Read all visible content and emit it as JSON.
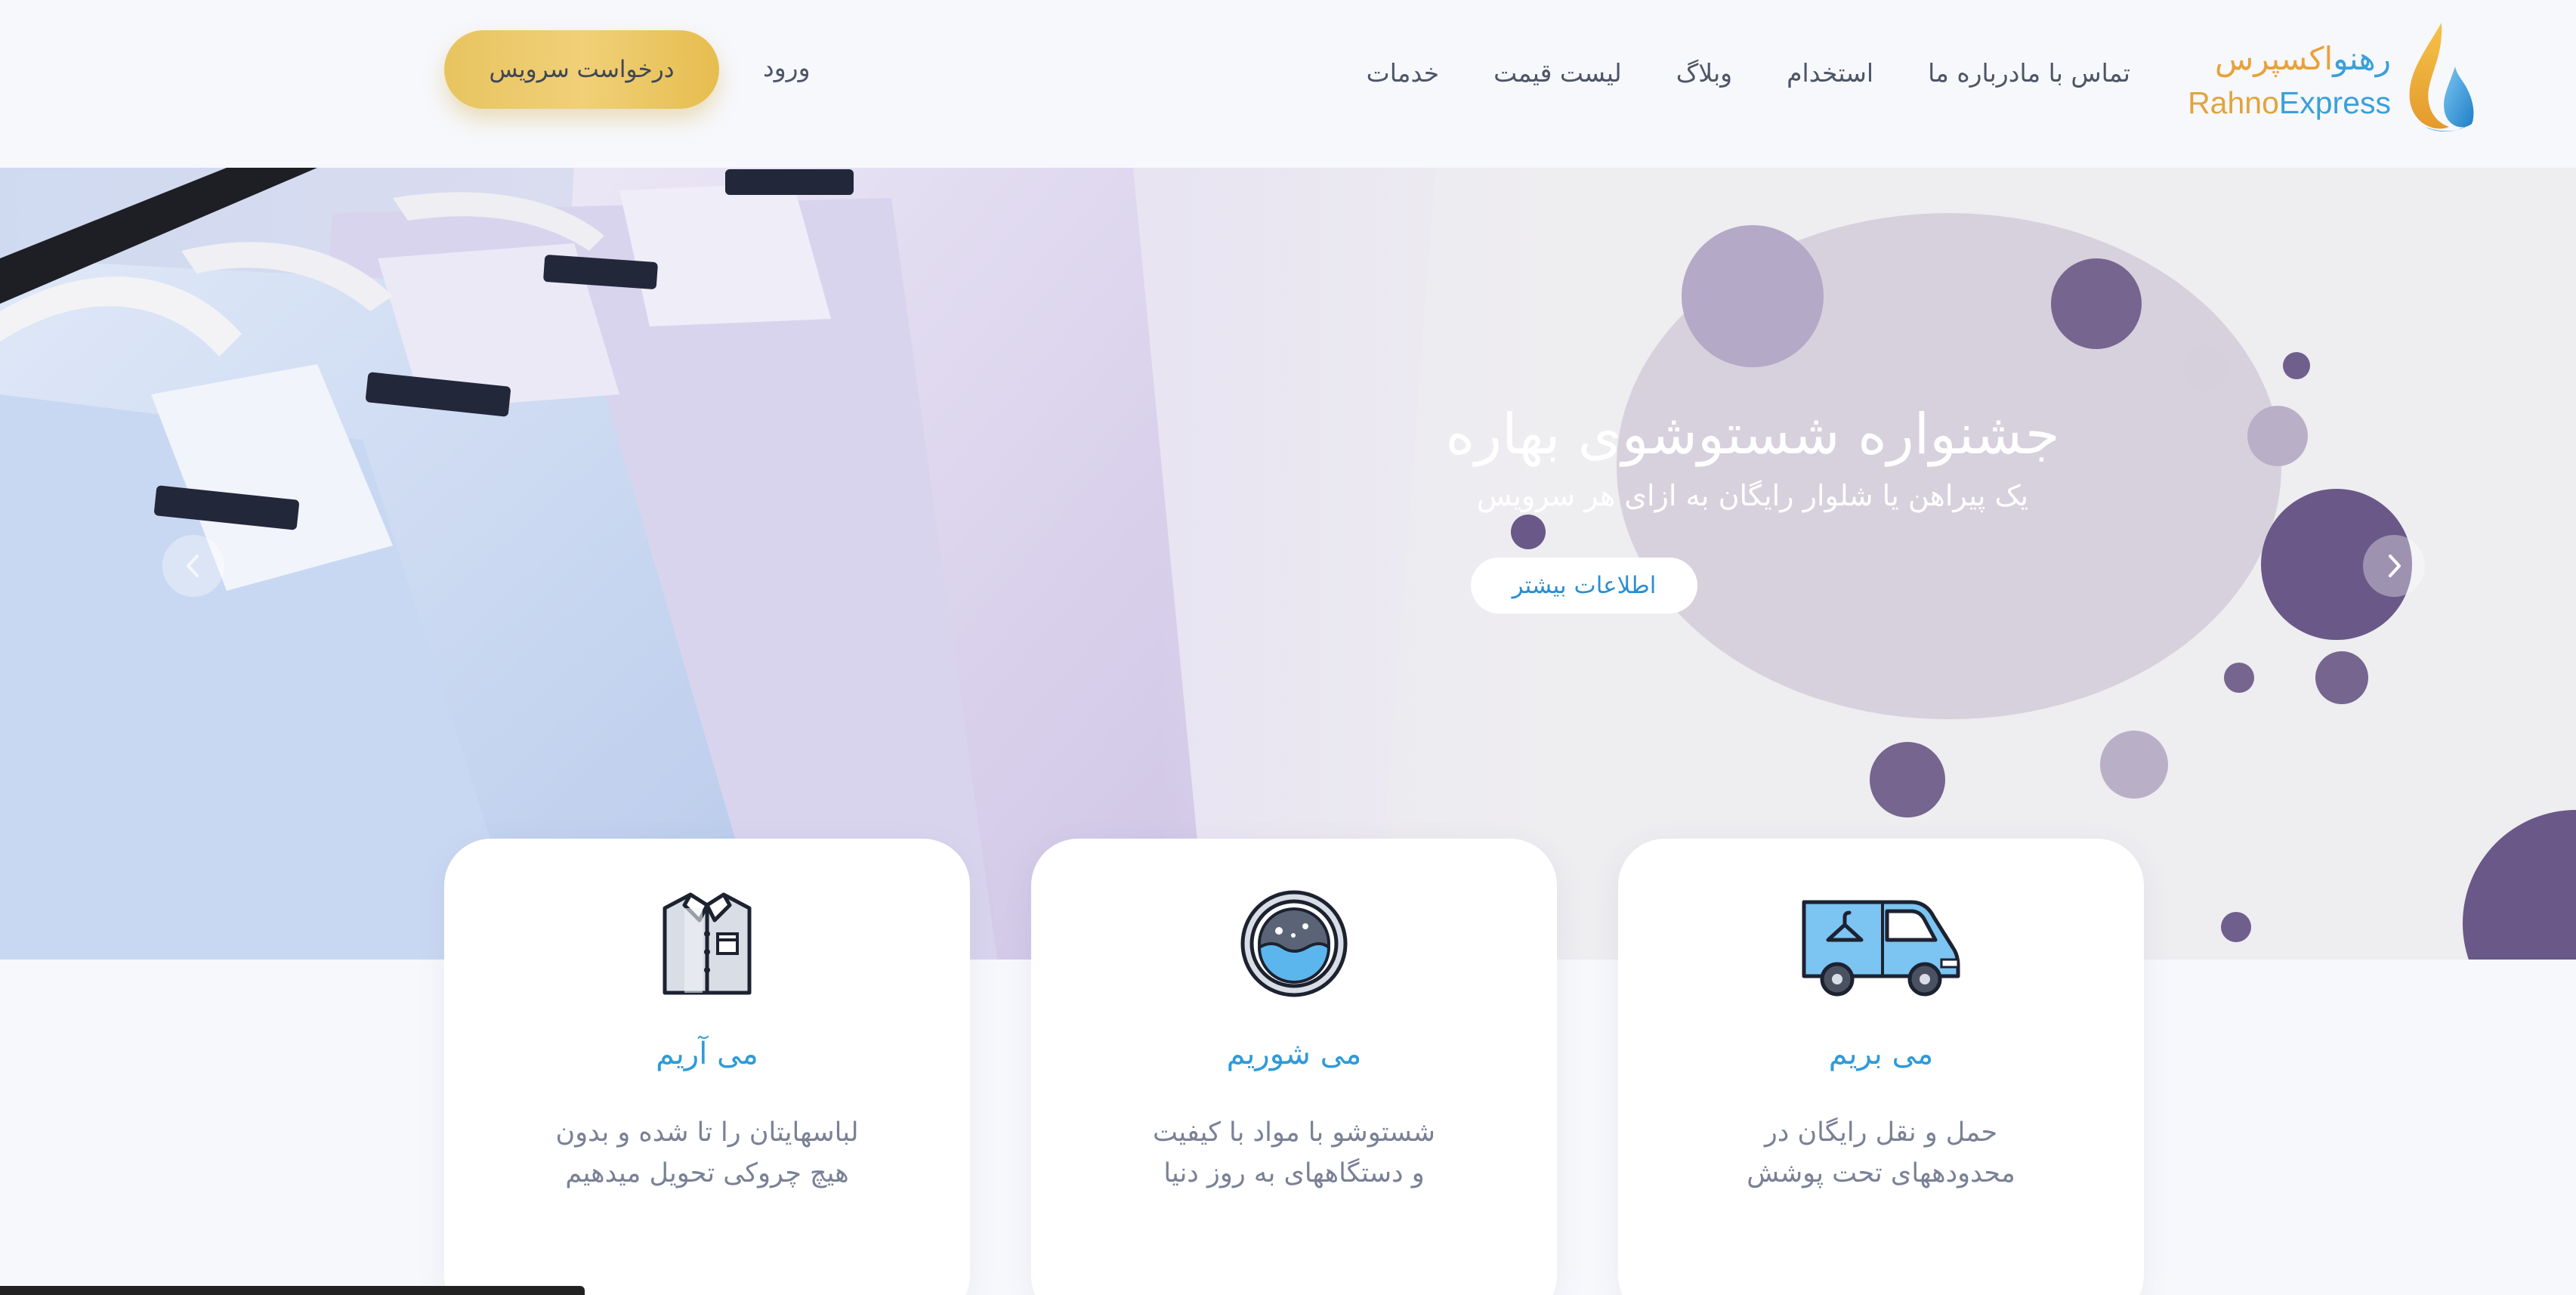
{
  "brand": {
    "name_fa_part1": "رهنو",
    "name_fa_part2": "اکسپرس",
    "name_en_part1": "Rahno",
    "name_en_part2": "Express"
  },
  "nav": {
    "items": [
      "خدمات",
      "لیست قیمت",
      "وبلاگ",
      "استخدام",
      "درباره ما",
      "تماس با ما"
    ],
    "login": "ورود",
    "cta": "درخواست سرویس"
  },
  "hero": {
    "title": "جشنواره شستوشوی بهاره",
    "subtitle": "یک پیراهن یا شلوار رایگان به ازای هر سرویس",
    "button": "اطلاعات بیشتر"
  },
  "cards": [
    {
      "icon": "shirt-icon",
      "title": "می آریم",
      "line1": "لباسهایتان را تا شده و بدون",
      "line2": "هیچ چروکی تحویل میدهیم"
    },
    {
      "icon": "washing-machine-icon",
      "title": "می شوریم",
      "line1": "شستوشو با مواد با کیفیت",
      "line2": "و دستگاههای به روز دنیا"
    },
    {
      "icon": "delivery-van-icon",
      "title": "می بریم",
      "line1": "حمل و نقل رایگان در",
      "line2": "محدودههای تحت پوشش"
    }
  ],
  "colors": {
    "accent_blue": "#2f9bd8",
    "cta_gold": "#e8c45f",
    "logo_orange": "#e1a43c",
    "bubble_purple": "#6e5c8e"
  }
}
